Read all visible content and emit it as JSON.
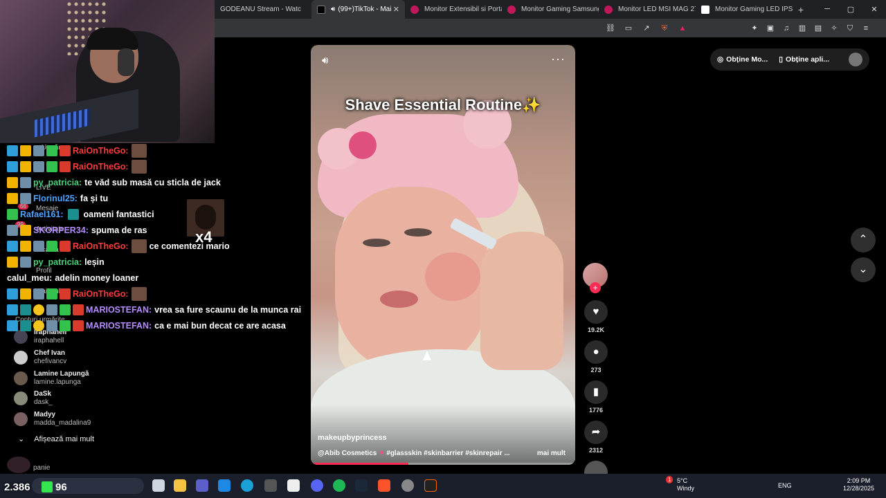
{
  "browser": {
    "tabs": [
      {
        "label": "GODEANU Stream - Watc",
        "active": false
      },
      {
        "label": "(99+)TikTok - Mai",
        "active": true
      },
      {
        "label": "Monitor Extensibil si Porta",
        "active": false
      },
      {
        "label": "Monitor Gaming Samsung",
        "active": false
      },
      {
        "label": "Monitor LED MSI MAG 27",
        "active": false
      },
      {
        "label": "Monitor Gaming LED IPS",
        "active": false
      }
    ],
    "new_tab": "+",
    "close_tab": "✕"
  },
  "chat": {
    "messages": [
      {
        "user": "RaiOnTheGo:",
        "text": "",
        "color": "#ff3b3b"
      },
      {
        "user": "RaiOnTheGo:",
        "text": "",
        "color": "#ff3b3b"
      },
      {
        "user": "py_patricia:",
        "text": "te văd sub masă cu sticla de jack",
        "color": "#48d07a"
      },
      {
        "user": "Florinul25:",
        "text": "fa și tu",
        "color": "#4da3ff"
      },
      {
        "user": "Rafael161:",
        "text": "oameni fantastici",
        "color": "#48d07a"
      },
      {
        "user": "SKORPER34:",
        "text": "spuma de ras",
        "color": "#4ac0ff"
      },
      {
        "user": "RaiOnTheGo:",
        "text": "ce comentezi mario",
        "color": "#ff3b3b"
      },
      {
        "user": "py_patricia:",
        "text": "leșin",
        "color": "#48d07a"
      },
      {
        "user": "calul_meu:",
        "text": "adelin money loaner",
        "color": "#ffffff"
      },
      {
        "user": "RaiOnTheGo:",
        "text": "",
        "color": "#ff3b3b"
      },
      {
        "user": "MARIOSTEFAN:",
        "text": "vrea sa fure scaunu de la munca rai",
        "color": "#b48cff"
      },
      {
        "user": "MARIOSTEFAN:",
        "text": "ca e mai bun decat ce are acasa",
        "color": "#b48cff"
      }
    ],
    "emote_multiplier": "x4"
  },
  "sidebar": {
    "faint_items": [
      "Urmăre",
      "LIVE",
      "Mesaje",
      "Activitate",
      "Încărca",
      "Profil",
      "Mai mult",
      "Conturi urmărite",
      "panie"
    ],
    "badge_count": "66",
    "badge_count2": "99",
    "accounts": [
      {
        "name": "Iraphahell",
        "user": "iraphahell"
      },
      {
        "name": "Chef Ivan",
        "user": "chefivancv"
      },
      {
        "name": "Lamine Lapungă",
        "user": "lamine.lapunga"
      },
      {
        "name": "DaSk",
        "user": "dask_"
      },
      {
        "name": "Madyy",
        "user": "madda_madalina9"
      }
    ],
    "show_more": "Afișează mai mult"
  },
  "video": {
    "title": "Shave Essential Routine✨",
    "author": "makeupbyprincess",
    "desc_mention": "@Abib Cosmetics",
    "desc_tags": "#glassskin #skinbarrier #skinrepair ...",
    "more": "mai mult",
    "progress": 0.37
  },
  "actions": {
    "likes": "19.2K",
    "comments": "273",
    "saves": "1776",
    "shares": "2312"
  },
  "topright": {
    "coins": "Obține Mo...",
    "app": "Obține apli..."
  },
  "stream": {
    "viewers": "2.386",
    "kick_viewers": "96"
  },
  "taskbar": {
    "weather_temp": "5°C",
    "weather_desc": "Windy",
    "weather_badge": "1",
    "lang": "ENG",
    "time": "2:09 PM",
    "date": "12/28/2025"
  }
}
